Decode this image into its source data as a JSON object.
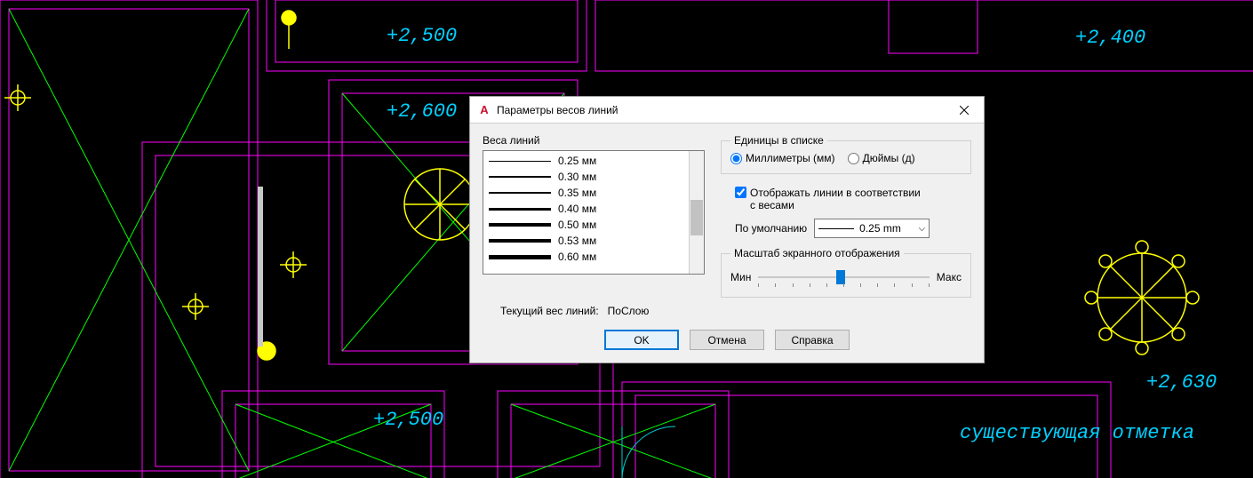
{
  "elevations": {
    "e1": "+2,500",
    "e2": "+2,600",
    "e3": "+2,400",
    "e4": "+2,500",
    "e5": "+2,630"
  },
  "note": "существующая отметка",
  "dialog": {
    "title": "Параметры весов линий",
    "left": {
      "label": "Веса линий",
      "items": [
        {
          "label": "0.25 мм",
          "h": 1
        },
        {
          "label": "0.30 мм",
          "h": 2
        },
        {
          "label": "0.35 мм",
          "h": 2
        },
        {
          "label": "0.40 мм",
          "h": 3
        },
        {
          "label": "0.50 мм",
          "h": 4
        },
        {
          "label": "0.53 мм",
          "h": 4
        },
        {
          "label": "0.60 мм",
          "h": 5
        }
      ],
      "current_label": "Текущий вес линий:",
      "current_value": "ПоСлою"
    },
    "right": {
      "units_legend": "Единицы в списке",
      "radio_mm": "Миллиметры (мм)",
      "radio_in": "Дюймы (д)",
      "chk": "Отображать линии в соответствии с весами",
      "default_label": "По умолчанию",
      "default_value": "0.25 mm",
      "scale_legend": "Масштаб экранного отображения",
      "min": "Мин",
      "max": "Макс"
    },
    "buttons": {
      "ok": "OK",
      "cancel": "Отмена",
      "help": "Справка"
    }
  }
}
